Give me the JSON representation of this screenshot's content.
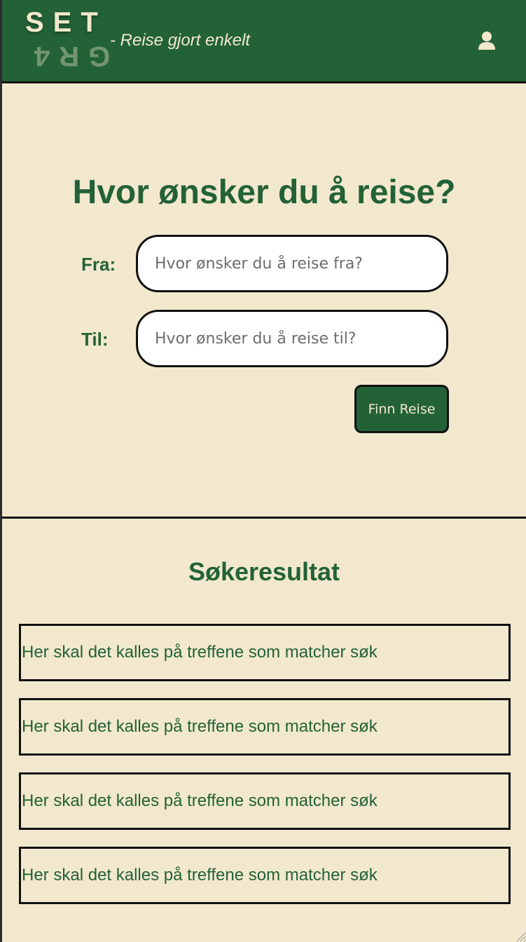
{
  "header": {
    "logo_top": "SET",
    "logo_bottom": "GR4",
    "tagline": "- Reise gjort enkelt",
    "user_icon": "user-icon",
    "background_color": "#236236",
    "text_color": "#f2e8cd"
  },
  "search": {
    "title": "Hvor ønsker du å reise?",
    "from_label": "Fra:",
    "from_placeholder": "Hvor ønsker du å reise fra?",
    "to_label": "Til:",
    "to_placeholder": "Hvor ønsker du å reise til?",
    "button_label": "Finn Reise"
  },
  "results": {
    "title": "Søkeresultat",
    "items": [
      "Her skal det kalles på treffene som matcher søk",
      "Her skal det kalles på treffene som matcher søk",
      "Her skal det kalles på treffene som matcher søk",
      "Her skal det kalles på treffene som matcher søk"
    ]
  },
  "colors": {
    "accent": "#236236",
    "background": "#f2e8cd",
    "border": "#111111"
  }
}
